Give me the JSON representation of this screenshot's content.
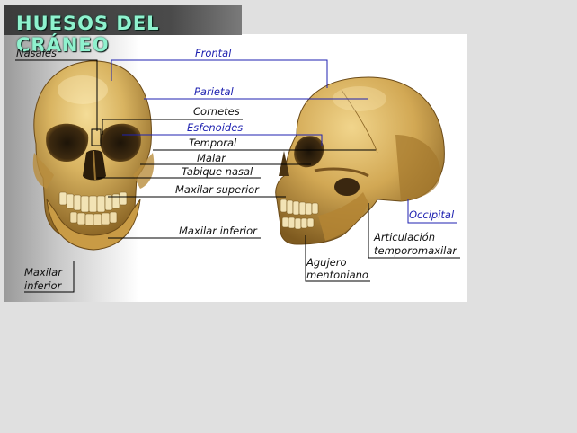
{
  "title": "HUESOS DEL CRÁNEO",
  "colors": {
    "title_text": "#8ff2ce",
    "label_blue": "#1f22b0",
    "label_black": "#111111",
    "bone_light": "#e7c97c",
    "bone_mid": "#c79a3f",
    "bone_dark": "#6b4a17",
    "background": "#e0e0e0"
  },
  "labels": {
    "nasales": "Nasales",
    "frontal": "Frontal",
    "parietal": "Parietal",
    "cornetes": "Cornetes",
    "esfenoides": "Esfenoides",
    "temporal": "Temporal",
    "malar": "Malar",
    "tabique_nasal": "Tabique nasal",
    "maxilar_superior": "Maxilar superior",
    "maxilar_inferior": "Maxilar inferior",
    "occipital": "Occipital",
    "articulacion_l1": "Articulación",
    "articulacion_l2": "temporomaxilar",
    "agujero_l1": "Agujero",
    "agujero_l2": "mentoniano",
    "maxilar_inf_left_l1": "Maxilar",
    "maxilar_inf_left_l2": "inferior"
  }
}
